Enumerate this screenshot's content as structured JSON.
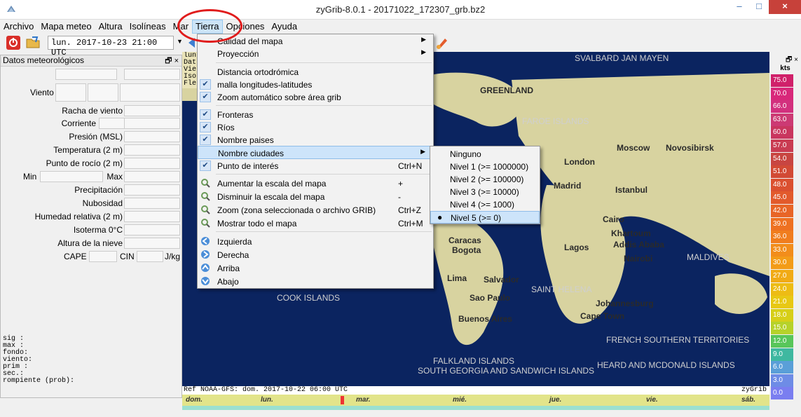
{
  "window": {
    "title": "zyGrib-8.0.1 - 20171022_172307_grb.bz2",
    "controls": [
      "–",
      "□",
      "×"
    ]
  },
  "menubar": {
    "items": [
      {
        "label": "Archivo"
      },
      {
        "label": "Mapa meteo"
      },
      {
        "label": "Altura"
      },
      {
        "label": "Isolíneas"
      },
      {
        "label": "Mar"
      },
      {
        "label": "Tierra",
        "active": true
      },
      {
        "label": "Opciones"
      },
      {
        "label": "Ayuda"
      }
    ]
  },
  "toolbar": {
    "date_value": "lun. 2017-10-23 21:00 UTC",
    "colors": {
      "stop": "#d9302a",
      "folder": "#e8b84a"
    }
  },
  "panel": {
    "title": "Datos meteorológicos",
    "head_icons": "🗗 ×",
    "rows": [
      {
        "label": "Viento"
      },
      {
        "label": "Racha de viento"
      },
      {
        "label": "Corriente"
      },
      {
        "label": "Presión (MSL)"
      },
      {
        "label": "Temperatura (2 m)"
      },
      {
        "label": "Punto de rocío (2 m)"
      },
      {
        "label": "Min",
        "label2": "Max"
      },
      {
        "label": "Precipitación"
      },
      {
        "label": "Nubosidad"
      },
      {
        "label": "Humedad relativa (2 m)"
      },
      {
        "label": "Isoterma 0°C"
      },
      {
        "label": "Altura de la nieve"
      },
      {
        "label": "CAPE",
        "label2": "CIN",
        "label3": "J/kg"
      }
    ],
    "bottom_text": [
      "sig :",
      "max  :",
      "fondo:",
      "viento:",
      "prim :",
      "sec.:",
      "rompiente (prob):"
    ]
  },
  "map": {
    "info_lines": [
      "lun",
      "Dat",
      "Vie",
      "Iso",
      "Fle"
    ],
    "labels": [
      {
        "text": "SVALBARD JAN MAYEN"
      },
      {
        "text": "GREENLAND"
      },
      {
        "text": "FAROE ISLANDS"
      },
      {
        "text": "Moscow"
      },
      {
        "text": "London"
      },
      {
        "text": "Novosibirsk"
      },
      {
        "text": "Istanbul"
      },
      {
        "text": "Madrid"
      },
      {
        "text": "Cairo"
      },
      {
        "text": "Khartoum"
      },
      {
        "text": "Caracas"
      },
      {
        "text": "Bogota"
      },
      {
        "text": "Lagos"
      },
      {
        "text": "Addis Ababa"
      },
      {
        "text": "Nairobi"
      },
      {
        "text": "Lima"
      },
      {
        "text": "Salvador"
      },
      {
        "text": "Sao Paulo"
      },
      {
        "text": "Buenos Aires"
      },
      {
        "text": "Johannesburg"
      },
      {
        "text": "Cape Town"
      },
      {
        "text": "COOK ISLANDS"
      },
      {
        "text": "SAINT HELENA"
      },
      {
        "text": "MALDIVES"
      },
      {
        "text": "FRENCH SOUTHERN TERRITORIES"
      },
      {
        "text": "HEARD AND MCDONALD ISLANDS"
      },
      {
        "text": "SOUTH GEORGIA AND SANDWICH ISLANDS"
      },
      {
        "text": "FALKLAND ISLANDS"
      }
    ],
    "ref_text": "Ref NOAA-GFS: dom. 2017-10-22 06:00 UTC",
    "brand": "zyGrib"
  },
  "timeline": {
    "days": [
      "dom.",
      "lun.",
      "mar.",
      "mié.",
      "jue.",
      "vie.",
      "sáb."
    ]
  },
  "legend": {
    "header_icons": "🗗 ×",
    "unit": "kts",
    "values": [
      {
        "v": "75.0",
        "c": "#d0206a"
      },
      {
        "v": "70.0",
        "c": "#d8287a"
      },
      {
        "v": "66.0",
        "c": "#d2307e"
      },
      {
        "v": "63.0",
        "c": "#cc3a74"
      },
      {
        "v": "60.0",
        "c": "#c9365f"
      },
      {
        "v": "57.0",
        "c": "#c93c52"
      },
      {
        "v": "54.0",
        "c": "#c84541"
      },
      {
        "v": "51.0",
        "c": "#d24a35"
      },
      {
        "v": "48.0",
        "c": "#db5030"
      },
      {
        "v": "45.0",
        "c": "#e25a2c"
      },
      {
        "v": "42.0",
        "c": "#e86527"
      },
      {
        "v": "39.0",
        "c": "#ee7122"
      },
      {
        "v": "36.0",
        "c": "#f07d1e"
      },
      {
        "v": "33.0",
        "c": "#f28d1b"
      },
      {
        "v": "30.0",
        "c": "#f39c18"
      },
      {
        "v": "27.0",
        "c": "#f1ab16"
      },
      {
        "v": "24.0",
        "c": "#edbc14"
      },
      {
        "v": "21.0",
        "c": "#e8c814"
      },
      {
        "v": "18.0",
        "c": "#d7cf18"
      },
      {
        "v": "15.0",
        "c": "#b6d22a"
      },
      {
        "v": "12.0",
        "c": "#58c65a"
      },
      {
        "v": "9.0",
        "c": "#3fb8a0"
      },
      {
        "v": "6.0",
        "c": "#5a9fd8"
      },
      {
        "v": "3.0",
        "c": "#6e8ce6"
      },
      {
        "v": "0.0",
        "c": "#7a7ef0"
      }
    ]
  },
  "tierra_menu": {
    "items": [
      {
        "label": "Calidad del mapa",
        "submenu": true
      },
      {
        "label": "Proyección",
        "submenu": true
      },
      {
        "label": "Distancia ortodrómica"
      },
      {
        "label": "malla longitudes-latitudes",
        "checked": true
      },
      {
        "label": "Zoom automático sobre área grib",
        "checked": true
      },
      {
        "label": "Fronteras",
        "checked": true
      },
      {
        "label": "Ríos",
        "checked": true
      },
      {
        "label": "Nombre paises",
        "checked": true
      },
      {
        "label": "Nombre ciudades",
        "submenu": true,
        "highlighted": true
      },
      {
        "label": "Punto de interés",
        "checked": true,
        "shortcut": "Ctrl+N"
      },
      {
        "label": "Aumentar la escala del mapa",
        "icon": "zoom-in-icon",
        "shortcut": "+"
      },
      {
        "label": "Disminuir la escala del mapa",
        "icon": "zoom-out-icon",
        "shortcut": "-"
      },
      {
        "label": "Zoom (zona seleccionada o archivo GRIB)",
        "icon": "zoom-area-icon",
        "shortcut": "Ctrl+Z"
      },
      {
        "label": "Mostrar todo el mapa",
        "icon": "zoom-all-icon",
        "shortcut": "Ctrl+M"
      },
      {
        "label": "Izquierda",
        "icon": "arrow-left-icon"
      },
      {
        "label": "Derecha",
        "icon": "arrow-right-icon"
      },
      {
        "label": "Arriba",
        "icon": "arrow-up-icon"
      },
      {
        "label": "Abajo",
        "icon": "arrow-down-icon"
      }
    ]
  },
  "cities_submenu": {
    "items": [
      {
        "label": "Ninguno"
      },
      {
        "label": "Nivel 1 (>= 1000000)"
      },
      {
        "label": "Nivel 2 (>= 100000)"
      },
      {
        "label": "Nivel 3 (>= 10000)"
      },
      {
        "label": "Nivel 4 (>= 1000)"
      },
      {
        "label": "Nivel 5 (>= 0)",
        "selected": true
      }
    ]
  }
}
